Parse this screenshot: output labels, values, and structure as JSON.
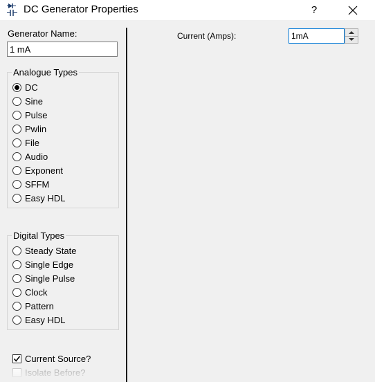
{
  "window": {
    "title": "DC Generator Properties",
    "help_label": "?",
    "icon": "generator-icon"
  },
  "generator": {
    "name_label": "Generator Name:",
    "name_value": "1 mA"
  },
  "analogue": {
    "title": "Analogue Types",
    "options": [
      {
        "label": "DC",
        "checked": true
      },
      {
        "label": "Sine",
        "checked": false
      },
      {
        "label": "Pulse",
        "checked": false
      },
      {
        "label": "Pwlin",
        "checked": false
      },
      {
        "label": "File",
        "checked": false
      },
      {
        "label": "Audio",
        "checked": false
      },
      {
        "label": "Exponent",
        "checked": false
      },
      {
        "label": "SFFM",
        "checked": false
      },
      {
        "label": "Easy HDL",
        "checked": false
      }
    ]
  },
  "digital": {
    "title": "Digital Types",
    "options": [
      {
        "label": "Steady State",
        "checked": false
      },
      {
        "label": "Single Edge",
        "checked": false
      },
      {
        "label": "Single Pulse",
        "checked": false
      },
      {
        "label": "Clock",
        "checked": false
      },
      {
        "label": "Pattern",
        "checked": false
      },
      {
        "label": "Easy HDL",
        "checked": false
      }
    ]
  },
  "options": {
    "current_source": {
      "label": "Current Source?",
      "checked": true
    },
    "isolate_before": {
      "label": "Isolate Before?",
      "checked": false,
      "disabled": true
    }
  },
  "current": {
    "label": "Current (Amps):",
    "value": "1mA"
  }
}
